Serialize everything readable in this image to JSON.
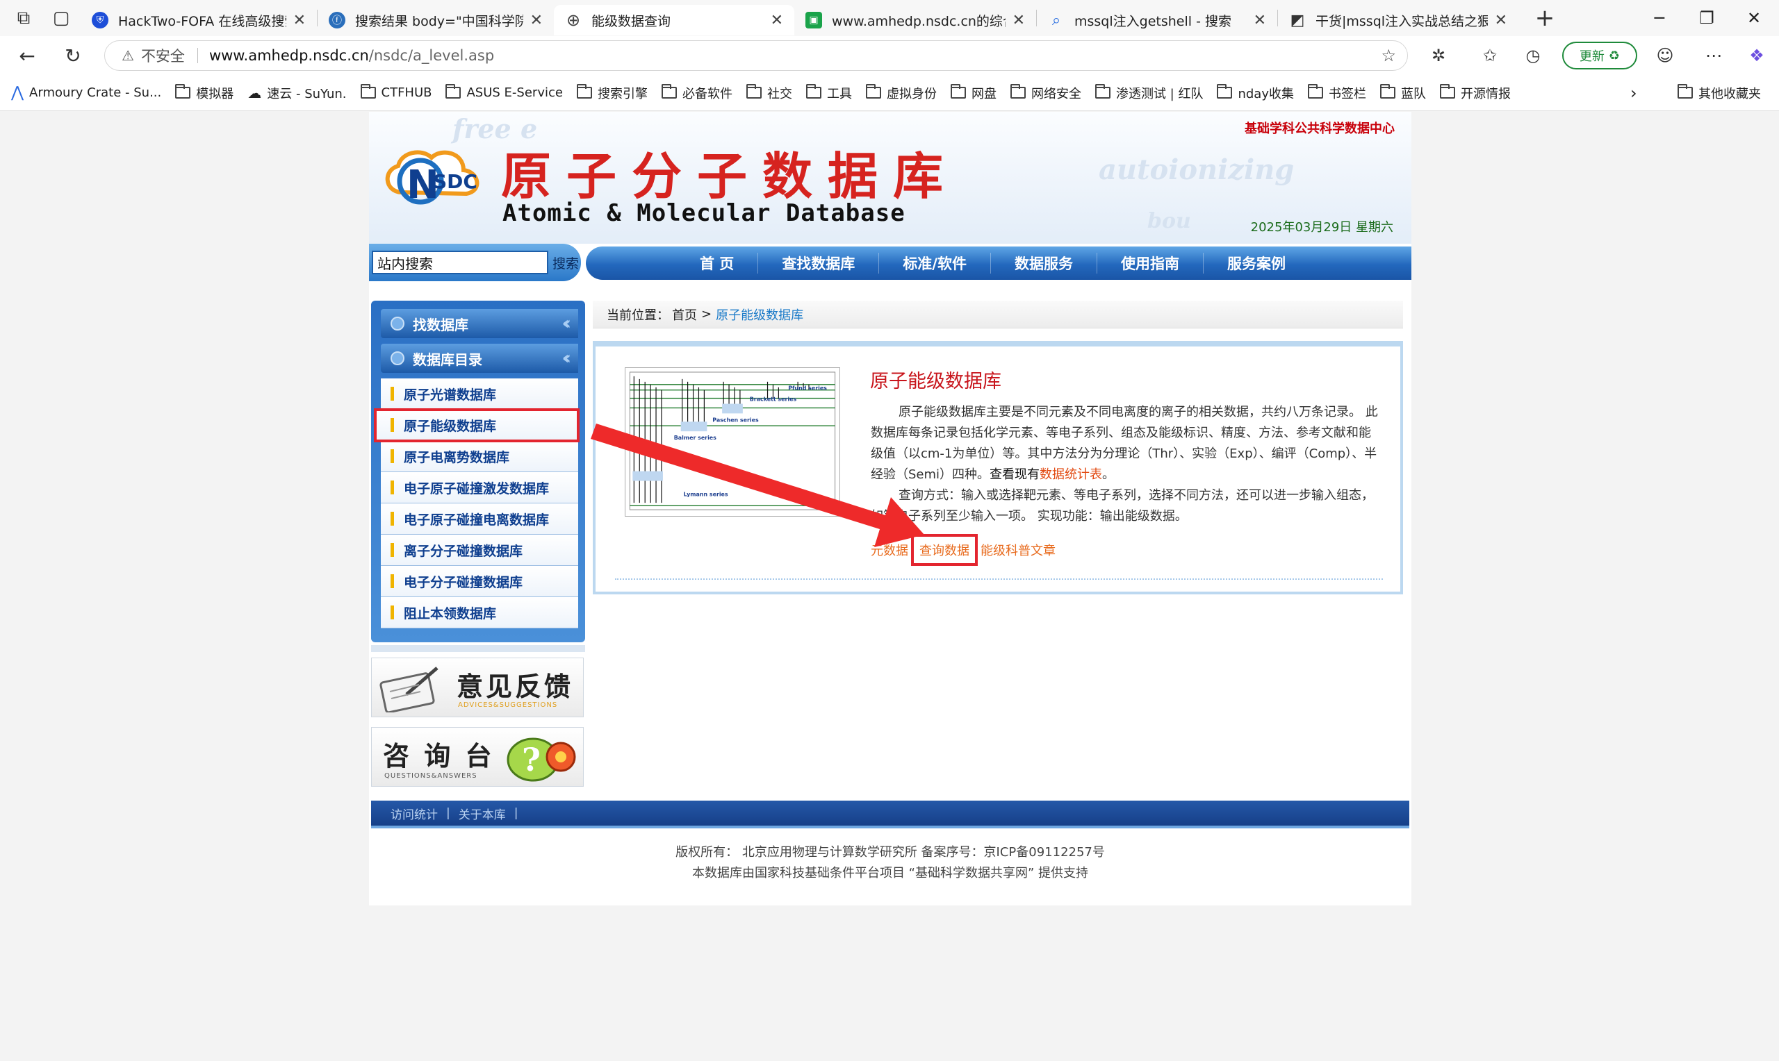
{
  "browser": {
    "tabs": [
      {
        "title": "HackTwo-FOFA 在线高级搜索小",
        "fav_color": "#1d4ed8",
        "active": false
      },
      {
        "title": "搜索结果 body=\"中国科学院\" &",
        "fav_color": "#2a6ebb",
        "active": false
      },
      {
        "title": "能级数据查询",
        "fav_color": "#555555",
        "active": true
      },
      {
        "title": "www.amhedp.nsdc.cn的综合查询",
        "fav_color": "#1aa34a",
        "active": false
      },
      {
        "title": "mssql注入getshell - 搜索",
        "fav_color": "#2b6fe0",
        "active": false
      },
      {
        "title": "干货|mssql注入实战总结之狠快",
        "fav_color": "#333333",
        "active": false
      }
    ],
    "url_warning": "不安全",
    "url_host": "www.amhedp.nsdc.cn",
    "url_path": "/nsdc/a_level.asp",
    "update_label": "更新",
    "bookmarks": [
      {
        "label": "Armoury Crate - Su...",
        "icon": "armoury-icon"
      },
      {
        "label": "模拟器",
        "icon": "folder-icon"
      },
      {
        "label": "速云 - SuYun.",
        "icon": "cloud-icon"
      },
      {
        "label": "CTFHUB",
        "icon": "folder-icon"
      },
      {
        "label": "ASUS E-Service",
        "icon": "folder-icon"
      },
      {
        "label": "搜索引擎",
        "icon": "folder-icon"
      },
      {
        "label": "必备软件",
        "icon": "folder-icon"
      },
      {
        "label": "社交",
        "icon": "folder-icon"
      },
      {
        "label": "工具",
        "icon": "folder-icon"
      },
      {
        "label": "虚拟身份",
        "icon": "folder-icon"
      },
      {
        "label": "网盘",
        "icon": "folder-icon"
      },
      {
        "label": "网络安全",
        "icon": "folder-icon"
      },
      {
        "label": "渗透测试 | 红队",
        "icon": "folder-icon"
      },
      {
        "label": "nday收集",
        "icon": "folder-icon"
      },
      {
        "label": "书签栏",
        "icon": "folder-icon"
      },
      {
        "label": "蓝队",
        "icon": "folder-icon"
      },
      {
        "label": "开源情报",
        "icon": "folder-icon"
      }
    ],
    "other_bookmarks": "其他收藏夹"
  },
  "site": {
    "org": "基础学科公共科学数据中心",
    "title_cn": "原子分子数据库",
    "title_en": "Atomic & Molecular Database",
    "logo_text": "SDC",
    "logo_letter": "N",
    "date": "2025年03月29日 星期六",
    "search_value": "站内搜索",
    "search_button": "搜索",
    "nav": [
      "首 页",
      "查找数据库",
      "标准/软件",
      "数据服务",
      "使用指南",
      "服务案例"
    ]
  },
  "sidebar": {
    "head1": "找数据库",
    "head2": "数据库目录",
    "items": [
      "原子光谱数据库",
      "原子能级数据库",
      "原子电离势数据库",
      "电子原子碰撞激发数据库",
      "电子原子碰撞电离数据库",
      "离子分子碰撞数据库",
      "电子分子碰撞数据库",
      "阻止本领数据库"
    ],
    "highlighted_index": 1,
    "banner1_big": "意见反馈",
    "banner1_small": "ADVICES&SUGGESTIONS",
    "banner2_big": "咨 询 台",
    "banner2_small": "QUESTIONS&ANSWERS"
  },
  "breadcrumb": {
    "prefix": "当前位置：",
    "home": "首页",
    "sep": ">",
    "current": "原子能级数据库"
  },
  "main": {
    "title": "原子能级数据库",
    "desc_1": "原子能级数据库主要是不同元素及不同电离度的离子的相关数据，共约八万条记录。 此数据库每条记录包括化学元素、等电子系列、组态及能级标识、精度、方法、参考文献和能级值（以cm-1为单位）等。其中方法分为分理论（Thr）、实验（Exp）、编评（Comp）、半经验（Semi）四种。",
    "desc_bold": "查看现有",
    "desc_link": "数据统计表",
    "desc_end": "。",
    "query_text": "查询方式：输入或选择靶元素、等电子系列，选择不同方法，还可以进一步输入组态，如等电子系列至少输入一项。 实现功能：输出能级数据。",
    "link_meta": "元数据",
    "link_query": "查询数据",
    "link_article": "能级科普文章",
    "diagram_labels": [
      "Pfund series",
      "Brackett series",
      "Paschen series",
      "Balmer series",
      "Lymann series"
    ]
  },
  "footer": {
    "links": [
      "访问统计",
      "|",
      "关于本库",
      "|"
    ],
    "copyright": "版权所有：  北京应用物理与计算数学研究所 备案序号：京ICP备09112257号",
    "support": "本数据库由国家科技基础条件平台项目 “基础科学数据共享网” 提供支持"
  },
  "colors": {
    "accent_red": "#d6231f",
    "nav_blue": "#2368bd",
    "highlight_red": "#e3252f",
    "link_orange": "#e86b1e"
  }
}
